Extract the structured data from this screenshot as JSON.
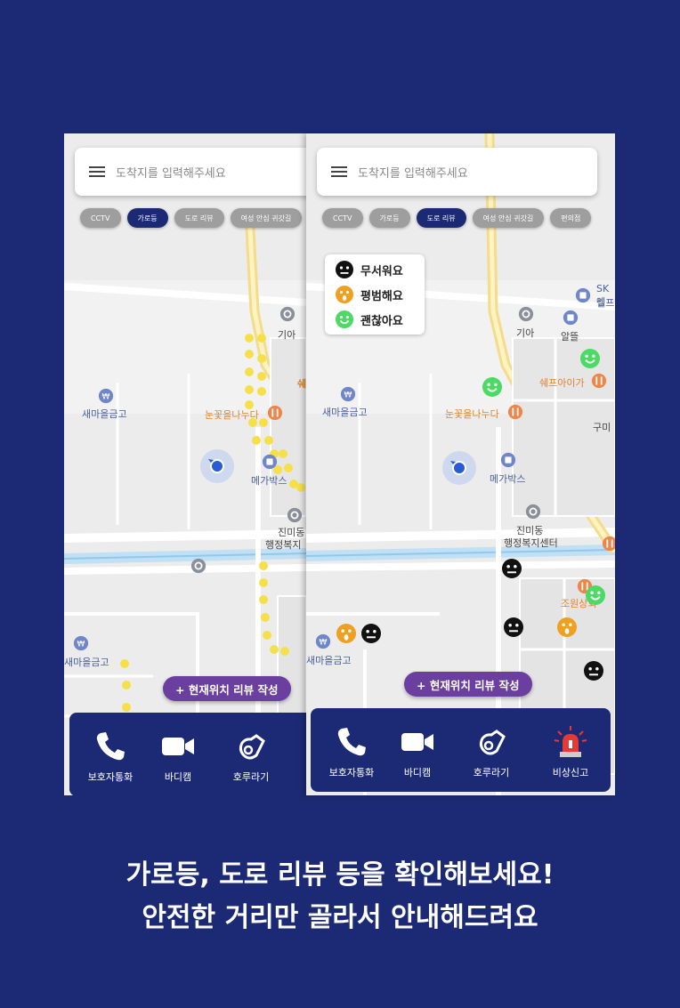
{
  "colors": {
    "background": "#1c2a76",
    "active_chip": "#1c2a76",
    "review_button": "#6a3fa0",
    "streetlight": "#f5e04a",
    "face_black": "#111111",
    "face_orange": "#f0a020",
    "face_green": "#4cd964"
  },
  "screen1": {
    "search_placeholder": "도착지를 입력해주세요",
    "chips": [
      "CCTV",
      "가로등",
      "도로 리뷰",
      "여성 안심 귀갓길"
    ],
    "active_chip": "가로등",
    "map_labels": {
      "kia": "기아",
      "saemaeul": "새마을금고",
      "nunkkot": "눈꽃을나누다",
      "megabox": "메가박스",
      "jinmidong": "진미동",
      "admin_center_partial": "행정복지",
      "saemaeul_bottom": "새마을금고",
      "swe": "쉐"
    },
    "review_button": "+ 현재위치 리뷰 작성",
    "bottom_bar": [
      {
        "label": "보호자통화",
        "icon": "phone-icon"
      },
      {
        "label": "바디캠",
        "icon": "video-camera-icon"
      },
      {
        "label": "호루라기",
        "icon": "whistle-icon"
      }
    ]
  },
  "screen2": {
    "search_placeholder": "도착지를 입력해주세요",
    "chips": [
      "CCTV",
      "가로등",
      "도로 리뷰",
      "여성 안심 귀갓길",
      "편의점"
    ],
    "active_chip": "도로 리뷰",
    "legend": [
      {
        "label": "무서워요",
        "icon": "scared-face-icon"
      },
      {
        "label": "평범해요",
        "icon": "neutral-face-icon"
      },
      {
        "label": "괜찮아요",
        "icon": "smile-face-icon"
      }
    ],
    "map_labels": {
      "kia": "기아",
      "albam": "알뜰",
      "sk": "SK엔",
      "self": "셀프",
      "chefai": "쉐프아이가",
      "gumi": "구미",
      "saemaeul": "새마을금고",
      "nunkkot": "눈꽃을나누다",
      "megabox": "메가박스",
      "jinmidong": "진미동",
      "admin_center": "행정복지센터",
      "joweon": "조원상회",
      "saemaeul_bottom": "새마을금고"
    },
    "review_button": "+ 현재위치 리뷰 작성",
    "bottom_bar": [
      {
        "label": "보호자통화",
        "icon": "phone-icon"
      },
      {
        "label": "바디캠",
        "icon": "video-camera-icon"
      },
      {
        "label": "호루라기",
        "icon": "whistle-icon"
      },
      {
        "label": "비상신고",
        "icon": "siren-icon"
      }
    ]
  },
  "caption": {
    "line1": "가로등, 도로 리뷰 등을 확인해보세요!",
    "line2": "안전한 거리만 골라서 안내해드려요"
  }
}
